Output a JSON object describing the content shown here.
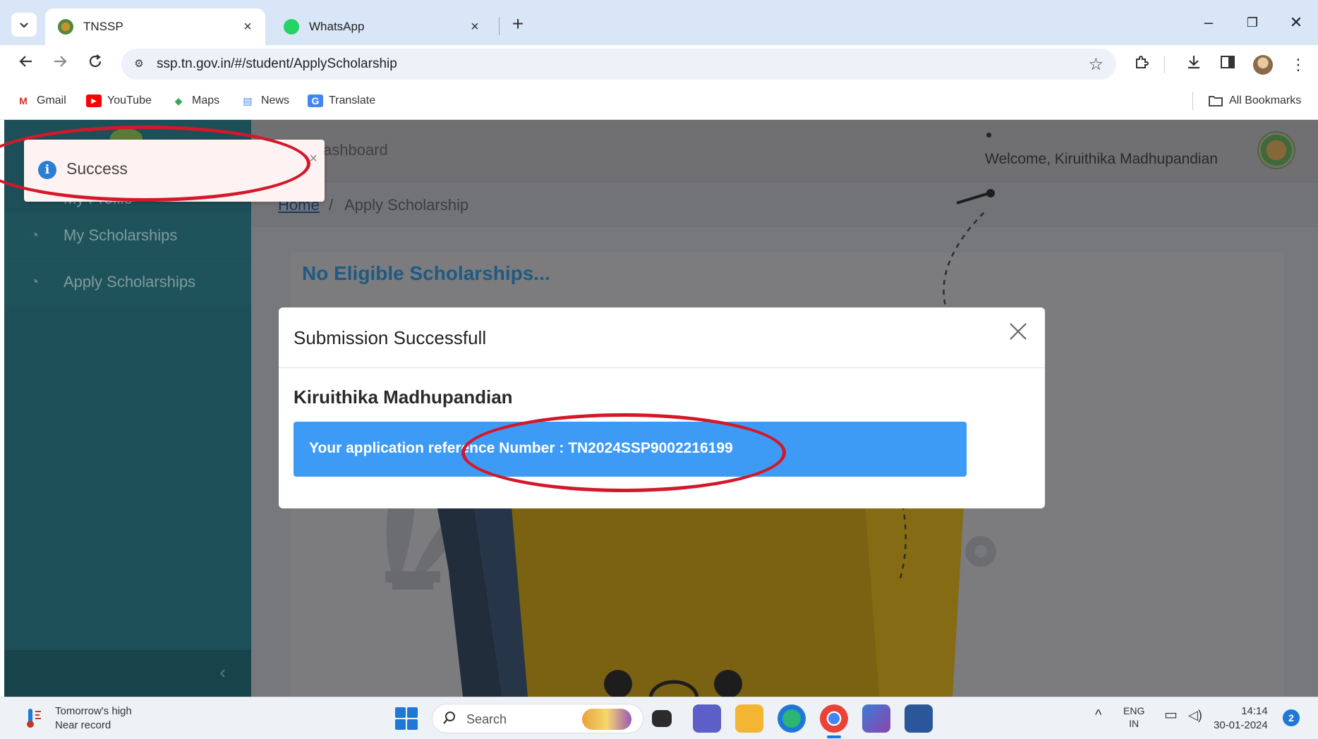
{
  "browser": {
    "tabs": [
      {
        "title": "TNSSP",
        "active": true,
        "favicon": "tnssp-emblem-icon",
        "close": "×"
      },
      {
        "title": "WhatsApp",
        "active": false,
        "favicon": "whatsapp-icon",
        "close": "×"
      }
    ],
    "new_tab": "+",
    "window_controls": {
      "minimize": "–",
      "restore": "❐",
      "close": "✕"
    },
    "url": "ssp.tn.gov.in/#/student/ApplyScholarship",
    "bookmarks": [
      {
        "label": "Gmail",
        "icon": "gmail-icon",
        "icon_text": "M",
        "color": "#d93025"
      },
      {
        "label": "YouTube",
        "icon": "youtube-icon",
        "icon_text": "▶",
        "color": "#ff0000"
      },
      {
        "label": "Maps",
        "icon": "maps-icon",
        "icon_text": "◆",
        "color": "#34a853"
      },
      {
        "label": "News",
        "icon": "news-icon",
        "icon_text": "▤",
        "color": "#4285f4"
      },
      {
        "label": "Translate",
        "icon": "translate-icon",
        "icon_text": "G",
        "color": "#4285f4"
      }
    ],
    "all_bookmarks": "All Bookmarks"
  },
  "sidebar": {
    "items": [
      {
        "label": "My Profile",
        "icon": "dashboard-gauge-icon"
      },
      {
        "label": "My Scholarships",
        "icon": "dashboard-gauge-icon"
      },
      {
        "label": "Apply Scholarships",
        "icon": "dashboard-gauge-icon"
      }
    ],
    "collapse_icon": "‹"
  },
  "header": {
    "dashboard_label": "ashboard",
    "welcome": "Welcome,  Kiruithika Madhupandian"
  },
  "breadcrumb": {
    "home": "Home",
    "separator": "/",
    "current": "Apply Scholarship"
  },
  "card": {
    "heading": "No Eligible Scholarships..."
  },
  "toast": {
    "message": "Success",
    "icon": "i",
    "close": "×"
  },
  "modal": {
    "title": "Submission Successfull",
    "close": "×",
    "name": "Kiruithika Madhupandian",
    "reference": "Your application reference Number : TN2024SSP9002216199"
  },
  "taskbar": {
    "weather_line1": "Tomorrow's high",
    "weather_line2": "Near record",
    "search": "Search",
    "lang_line1": "ENG",
    "lang_line2": "IN",
    "time": "14:14",
    "date": "30-01-2024",
    "notifications": "2"
  },
  "colors": {
    "sidebar": "#1d4f58",
    "modal_ref_box": "#3d9bf5",
    "heading": "#1b5c86",
    "annotation": "#d3182a",
    "illustration_yellow": "#7e640c"
  }
}
